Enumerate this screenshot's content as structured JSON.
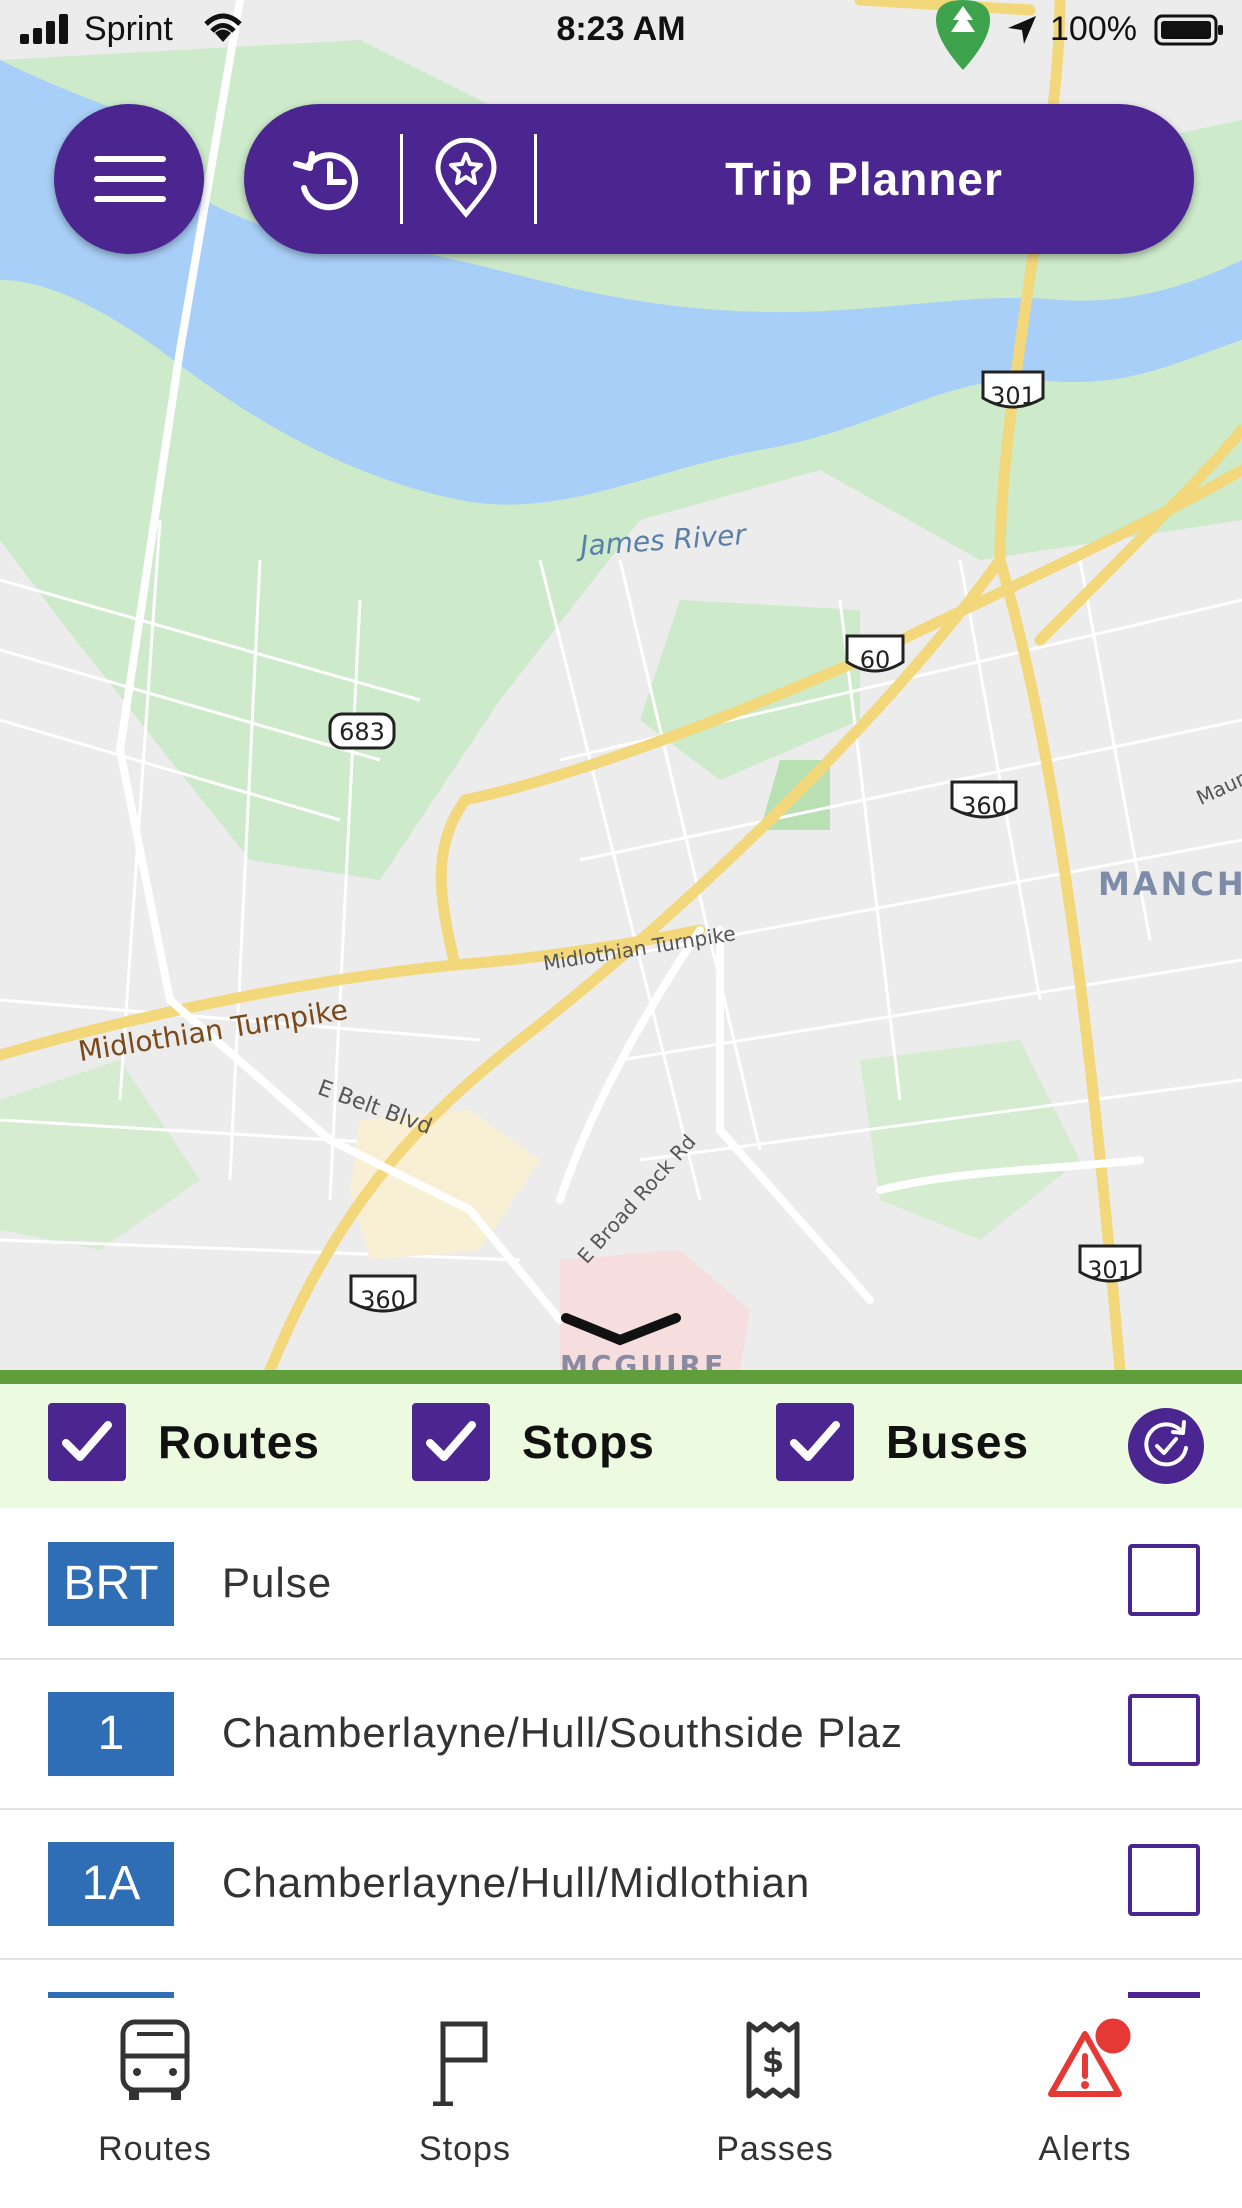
{
  "status_bar": {
    "carrier": "Sprint",
    "time": "8:23 AM",
    "battery": "100%"
  },
  "header": {
    "title": "Trip Planner",
    "menu_icon": "hamburger-menu-icon",
    "history_icon": "history-icon",
    "favorites_icon": "star-pin-icon"
  },
  "map": {
    "labels": {
      "river": "James River",
      "road_main": "Midlothian Turnpike",
      "road_small": "Midlothian Turnpike",
      "belt": "E Belt Blvd",
      "broad_rock": "E Broad Rock Rd",
      "area": "MANCH",
      "area2": "MCGUIRE",
      "maury": "Maur"
    },
    "shields": [
      "301",
      "60",
      "683",
      "360",
      "301",
      "360"
    ]
  },
  "filters": {
    "routes": {
      "label": "Routes",
      "checked": true
    },
    "stops": {
      "label": "Stops",
      "checked": true
    },
    "buses": {
      "label": "Buses",
      "checked": true
    },
    "refresh_icon": "refresh-check-icon"
  },
  "routes": [
    {
      "badge": "BRT",
      "name": "Pulse",
      "checked": false
    },
    {
      "badge": "1",
      "name": "Chamberlayne/Hull/Southside Plaz",
      "checked": false
    },
    {
      "badge": "1A",
      "name": "Chamberlayne/Hull/Midlothian",
      "checked": false
    }
  ],
  "tabs": [
    {
      "label": "Routes",
      "icon": "bus-icon"
    },
    {
      "label": "Stops",
      "icon": "stop-flag-icon"
    },
    {
      "label": "Passes",
      "icon": "ticket-icon"
    },
    {
      "label": "Alerts",
      "icon": "alert-icon"
    }
  ],
  "colors": {
    "brand": "#4b2590",
    "route_badge": "#2f6db5",
    "alert": "#e53935",
    "accent_green": "#5f9e3b"
  }
}
